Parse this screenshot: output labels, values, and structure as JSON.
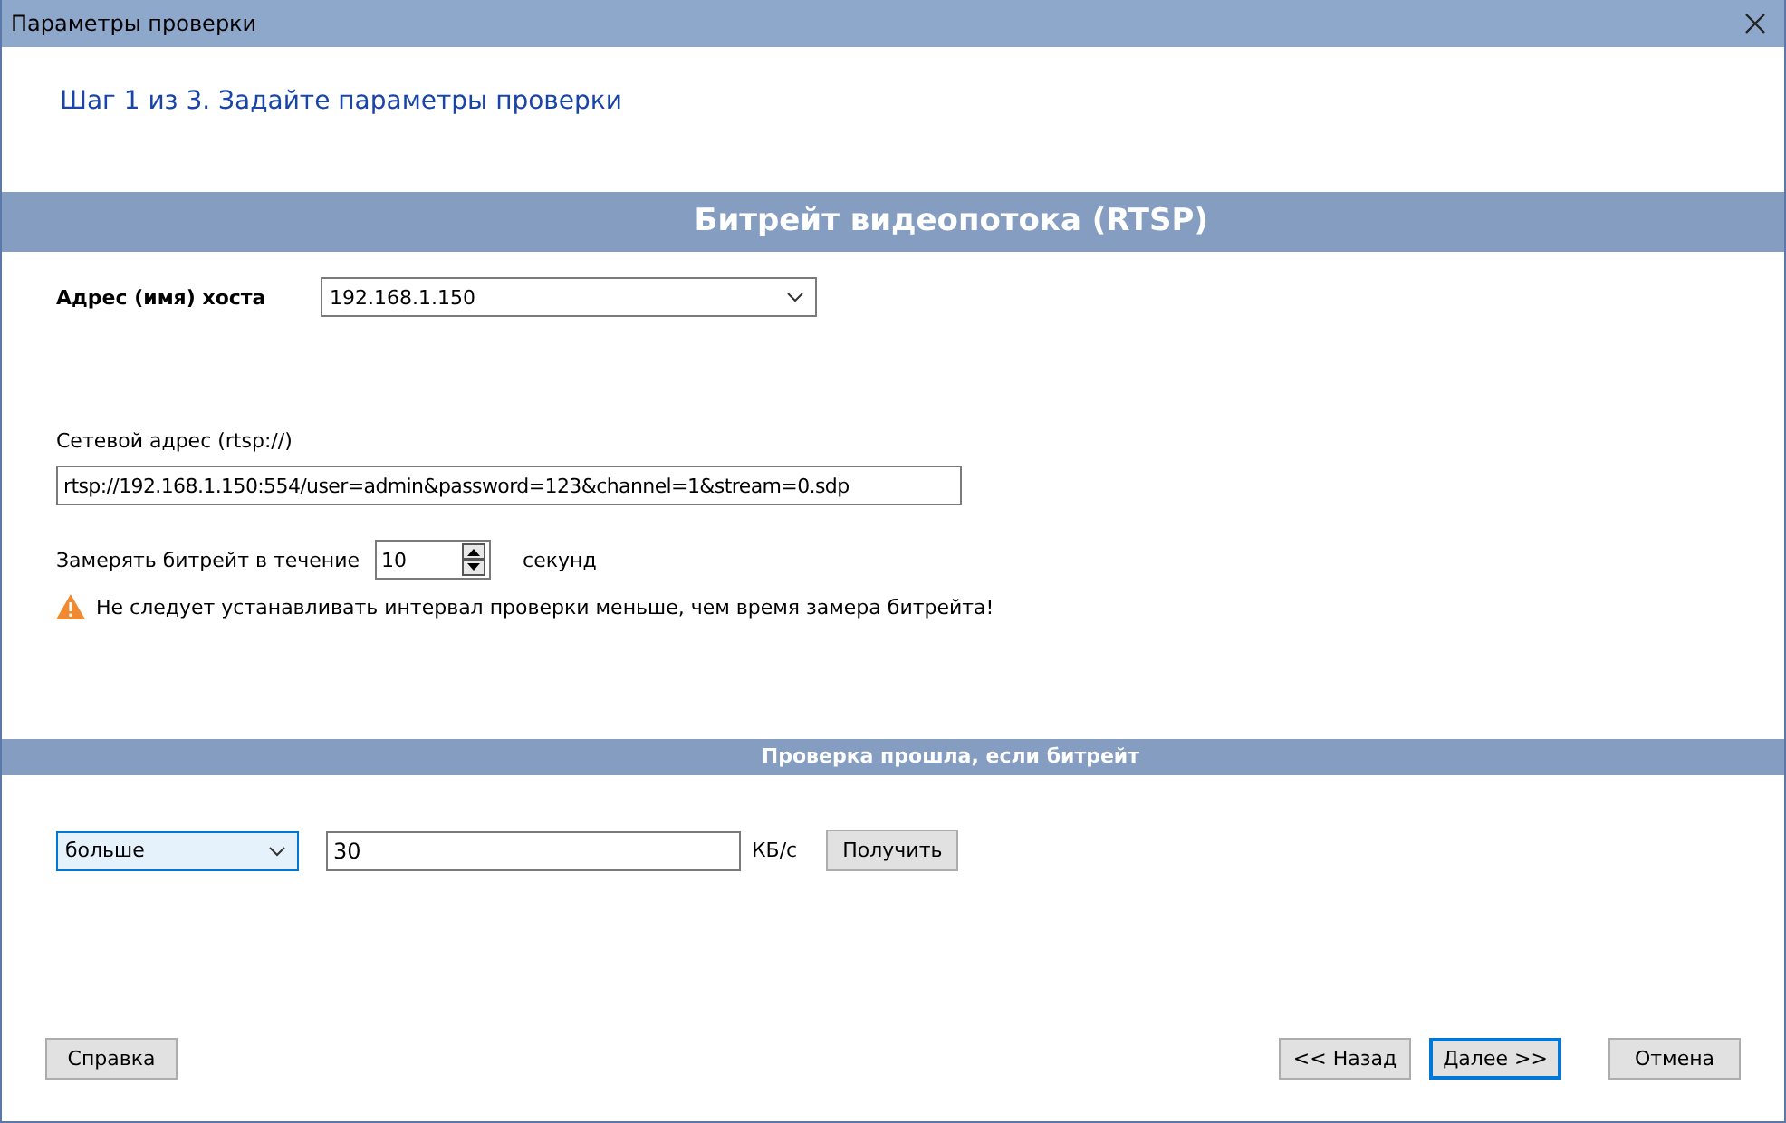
{
  "window": {
    "title": "Параметры проверки"
  },
  "step": "Шаг 1 из 3. Задайте параметры проверки",
  "section_title": "Битрейт видеопотока (RTSP)",
  "host": {
    "label": "Адрес (имя) хоста",
    "value": "192.168.1.150"
  },
  "url": {
    "label": "Сетевой адрес (rtsp://)",
    "value": "rtsp://192.168.1.150:554/user=admin&password=123&channel=1&stream=0.sdp"
  },
  "duration": {
    "label": "Замерять битрейт в течение",
    "value": "10",
    "unit": "секунд"
  },
  "warning": "Не следует устанавливать интервал проверки меньше, чем время замера битрейта!",
  "condition_title": "Проверка прошла, если битрейт",
  "condition": {
    "operator": "больше",
    "focused": true,
    "value": "30",
    "unit": "КБ/с",
    "fetch_button": "Получить"
  },
  "buttons": [
    {
      "label": "Справка",
      "default": false
    },
    {
      "label": "<< Назад",
      "default": false
    },
    {
      "label": "Далее >>",
      "default": true
    },
    {
      "label": "Отмена",
      "default": false
    }
  ]
}
